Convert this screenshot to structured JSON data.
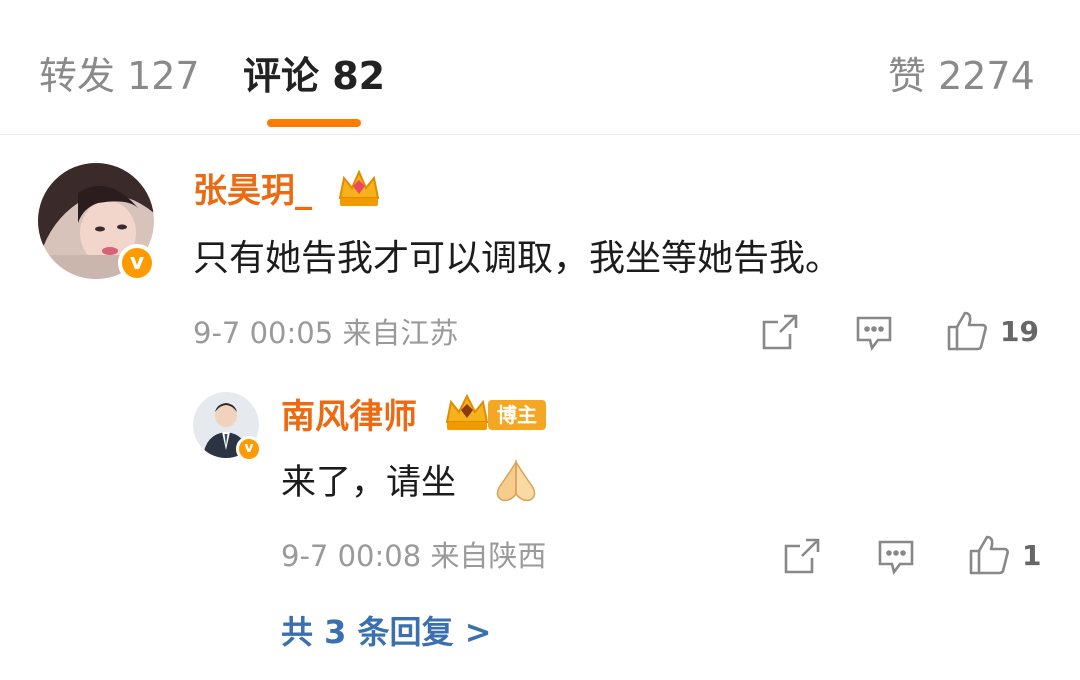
{
  "tabs": {
    "repost": "转发 127",
    "comments": "评论 82",
    "likes": "赞 2274"
  },
  "comment": {
    "author": "张昊玥_",
    "verify_mark": "v",
    "text": "只有她告我才可以调取，我坐等她告我。",
    "time_location": "9-7 00:05  来自江苏",
    "like_count": "19"
  },
  "reply": {
    "author": "南风律师",
    "verify_mark": "v",
    "badge": "博主",
    "text": "来了，请坐",
    "time_location": "9-7 00:08  来自陕西",
    "like_count": "1",
    "more_replies": "共 3 条回复 >"
  },
  "colors": {
    "accent": "#ff7a00",
    "name": "#ec6a12",
    "link": "#3a6fb0",
    "meta": "#9a9a9a"
  },
  "icons": [
    "forward-icon",
    "comment-icon",
    "thumbs-up-icon",
    "crown-icon",
    "praying-hands-emoji"
  ]
}
